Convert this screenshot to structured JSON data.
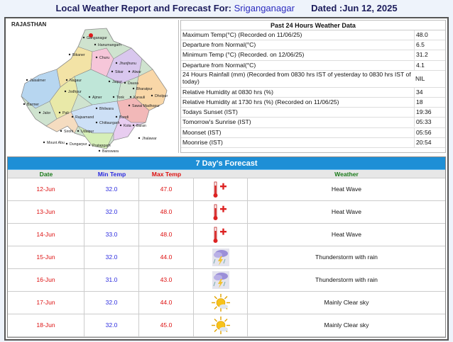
{
  "header": {
    "title_prefix": "Local Weather Report and Forecast For:",
    "city": "Sriganganagar",
    "dated": "Dated :Jun 12, 2025"
  },
  "map": {
    "state_label": "RAJASTHAN",
    "places": [
      "Ganganagar",
      "Hanumangarh",
      "Bikaner",
      "Churu",
      "Jhunjhunu",
      "Sikar",
      "Alwar",
      "Jaisalmer",
      "Nagaur",
      "Jaipur",
      "Dausa",
      "Bharatpur",
      "Dholpur",
      "Karauli",
      "Sawai Madhopur",
      "Tonk",
      "Ajmer",
      "Jodhpur",
      "Barmer",
      "Jalor",
      "Pali",
      "Rajsamand",
      "Bhilwara",
      "Bundi",
      "Kota",
      "Baran",
      "Jhalawar",
      "Chittaurgarh",
      "Udaipur",
      "Sirohi",
      "Mount Abu",
      "Dungarpur",
      "Pratapgarh",
      "Banswara"
    ]
  },
  "stats": {
    "heading": "Past 24 Hours Weather Data",
    "rows": [
      {
        "label": "Maximum Temp(°C) (Recorded on 11/06/25)",
        "value": "48.0"
      },
      {
        "label": "Departure from Normal(°C)",
        "value": "6.5"
      },
      {
        "label": "Minimum Temp (°C) (Recorded. on 12/06/25)",
        "value": "31.2"
      },
      {
        "label": "Departure from Normal(°C)",
        "value": "4.1"
      },
      {
        "label": "24 Hours Rainfall (mm) (Recorded from 0830 hrs IST of yesterday to 0830 hrs IST of today)",
        "value": "NIL"
      },
      {
        "label": "Relative Humidity at 0830 hrs (%)",
        "value": "34"
      },
      {
        "label": "Relative Humidity at 1730 hrs (%) (Recorded on 11/06/25)",
        "value": "18"
      },
      {
        "label": "Todays Sunset (IST)",
        "value": "19:36"
      },
      {
        "label": "Tomorrow's Sunrise (IST)",
        "value": "05:33"
      },
      {
        "label": "Moonset (IST)",
        "value": "05:56"
      },
      {
        "label": "Moonrise (IST)",
        "value": "20:54"
      }
    ]
  },
  "forecast": {
    "heading": "7 Day's Forecast",
    "columns": {
      "date": "Date",
      "min": "Min Temp",
      "max": "Max Temp",
      "weather": "Weather"
    },
    "rows": [
      {
        "date": "12-Jun",
        "min": "32.0",
        "max": "47.0",
        "icon": "heat-wave-icon",
        "weather": "Heat Wave"
      },
      {
        "date": "13-Jun",
        "min": "32.0",
        "max": "48.0",
        "icon": "heat-wave-icon",
        "weather": "Heat Wave"
      },
      {
        "date": "14-Jun",
        "min": "33.0",
        "max": "48.0",
        "icon": "heat-wave-icon",
        "weather": "Heat Wave"
      },
      {
        "date": "15-Jun",
        "min": "32.0",
        "max": "44.0",
        "icon": "thunderstorm-icon",
        "weather": "Thunderstorm with rain"
      },
      {
        "date": "16-Jun",
        "min": "31.0",
        "max": "43.0",
        "icon": "thunderstorm-icon",
        "weather": "Thunderstorm with rain"
      },
      {
        "date": "17-Jun",
        "min": "32.0",
        "max": "44.0",
        "icon": "clear-sky-icon",
        "weather": "Mainly Clear sky"
      },
      {
        "date": "18-Jun",
        "min": "32.0",
        "max": "45.0",
        "icon": "clear-sky-icon",
        "weather": "Mainly Clear sky"
      }
    ]
  },
  "colors": {
    "forecast_header": "#1e8fd6",
    "date_text": "#dd1111",
    "min_text": "#2b2bdf",
    "max_text": "#dd1111"
  }
}
